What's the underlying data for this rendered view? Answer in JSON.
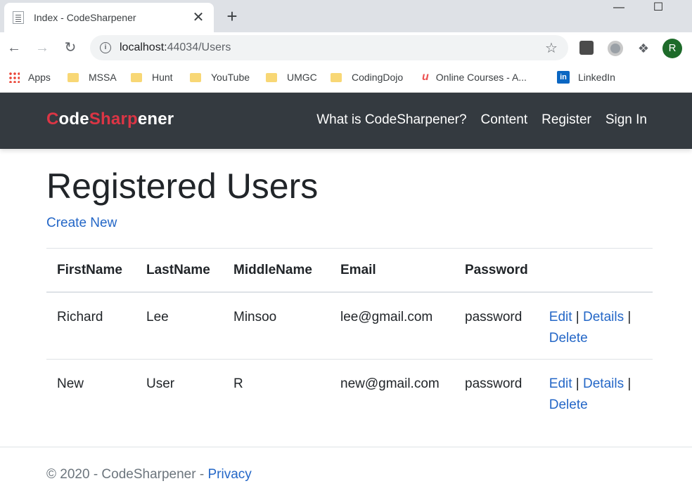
{
  "browser": {
    "tab_title": "Index - CodeSharpener",
    "tab_close": "✕",
    "new_tab": "+",
    "url_host": "localhost:",
    "url_path": "44034/Users",
    "avatar_letter": "R",
    "bookmarks": [
      {
        "label": "Apps",
        "icon": "apps-grid-icon"
      },
      {
        "label": "MSSA",
        "icon": "folder-icon"
      },
      {
        "label": "Hunt",
        "icon": "folder-icon"
      },
      {
        "label": "YouTube",
        "icon": "folder-icon"
      },
      {
        "label": "UMGC",
        "icon": "folder-icon"
      },
      {
        "label": "CodingDojo",
        "icon": "folder-icon"
      },
      {
        "label": "Online Courses - A...",
        "icon": "udemy-icon"
      },
      {
        "label": "LinkedIn",
        "icon": "linkedin-icon"
      }
    ]
  },
  "site": {
    "brand_c": "C",
    "brand_ode": "ode",
    "brand_sharp": "Sharp",
    "brand_ener": "ener",
    "nav": [
      "What is CodeSharpener?",
      "Content",
      "Register",
      "Sign In"
    ]
  },
  "page": {
    "title": "Registered Users",
    "create_new": "Create New",
    "columns": [
      "FirstName",
      "LastName",
      "MiddleName",
      "Email",
      "Password"
    ],
    "rows": [
      {
        "first": "Richard",
        "last": "Lee",
        "middle": "Minsoo",
        "email": "lee@gmail.com",
        "password": "password"
      },
      {
        "first": "New",
        "last": "User",
        "middle": "R",
        "email": "new@gmail.com",
        "password": "password"
      }
    ],
    "actions": {
      "edit": "Edit",
      "details": "Details",
      "delete": "Delete",
      "sep": "|"
    }
  },
  "footer": {
    "copyright": "© 2020 - CodeSharpener - ",
    "privacy": "Privacy"
  }
}
